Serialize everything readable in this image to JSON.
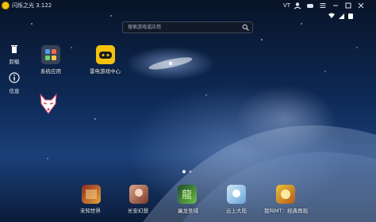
{
  "titlebar": {
    "app_name": "闪烁之光 3.122",
    "vt_label": "VT"
  },
  "search": {
    "placeholder": "搜索游戏或应用"
  },
  "sidebar": {
    "uninstall_label": "卸载",
    "info_label": "信息"
  },
  "desktop_apps": [
    {
      "label": "系统应用"
    },
    {
      "label": "雷电游戏中心"
    },
    {
      "label": ""
    }
  ],
  "dock": [
    {
      "label": "未知世界"
    },
    {
      "label": "长安幻想"
    },
    {
      "label": "屠龙圣域"
    },
    {
      "label": "云上大陆"
    },
    {
      "label": "我叫MT：经典再现"
    }
  ],
  "page_indicator": {
    "pages": 2,
    "current": 1
  },
  "colors": {
    "accent_yellow": "#f4c20d",
    "titlebar_bg": "#0a1428"
  }
}
